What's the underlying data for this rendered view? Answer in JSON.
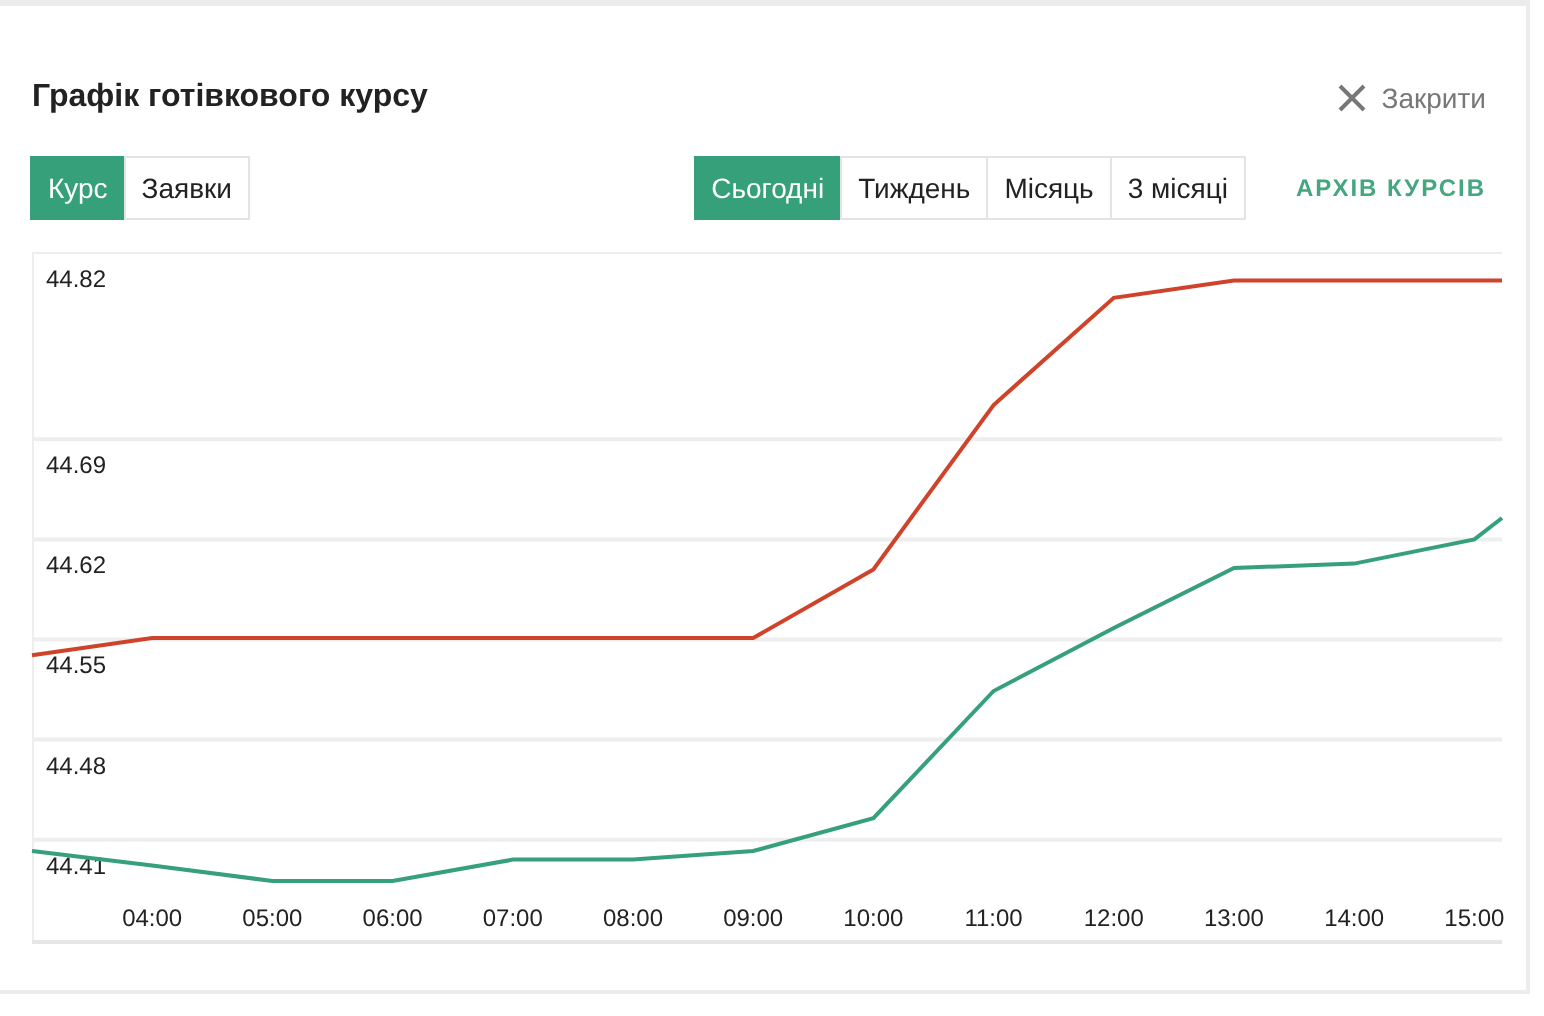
{
  "title": "Графік готівкового курсу",
  "close": {
    "label": "Закрити"
  },
  "view_tabs": [
    {
      "label": "Курс",
      "selected": true
    },
    {
      "label": "Заявки",
      "selected": false
    }
  ],
  "period_tabs": [
    {
      "label": "Сьогодні",
      "selected": true
    },
    {
      "label": "Тиждень",
      "selected": false
    },
    {
      "label": "Місяць",
      "selected": false
    },
    {
      "label": "3 місяці",
      "selected": false
    }
  ],
  "archive_link": "АРХІВ КУРСІВ",
  "chart_data": {
    "type": "line",
    "x": [
      3,
      4,
      5,
      6,
      7,
      8,
      9,
      10,
      11,
      12,
      13,
      14,
      15,
      15.23
    ],
    "series": [
      {
        "color": "#d0432b",
        "values": [
          44.539,
          44.551,
          44.551,
          44.551,
          44.551,
          44.551,
          44.551,
          44.599,
          44.714,
          44.789,
          44.801,
          44.801,
          44.801,
          44.801
        ]
      },
      {
        "color": "#36a07a",
        "values": [
          44.402,
          44.392,
          44.381,
          44.381,
          44.396,
          44.396,
          44.402,
          44.425,
          44.514,
          44.558,
          44.6,
          44.603,
          44.62,
          44.635
        ]
      }
    ],
    "grid": true,
    "xlim": [
      3,
      15.23
    ],
    "ylim": [
      44.337,
      44.821
    ],
    "xticks": [
      {
        "value": 4,
        "label": "04:00"
      },
      {
        "value": 5,
        "label": "05:00"
      },
      {
        "value": 6,
        "label": "06:00"
      },
      {
        "value": 7,
        "label": "07:00"
      },
      {
        "value": 8,
        "label": "08:00"
      },
      {
        "value": 9,
        "label": "09:00"
      },
      {
        "value": 10,
        "label": "10:00"
      },
      {
        "value": 11,
        "label": "11:00"
      },
      {
        "value": 12,
        "label": "12:00"
      },
      {
        "value": 13,
        "label": "13:00"
      },
      {
        "value": 14,
        "label": "14:00"
      },
      {
        "value": 15,
        "label": "15:00"
      }
    ],
    "yticks": [
      44.41,
      44.48,
      44.55,
      44.62,
      44.69,
      44.82
    ]
  }
}
